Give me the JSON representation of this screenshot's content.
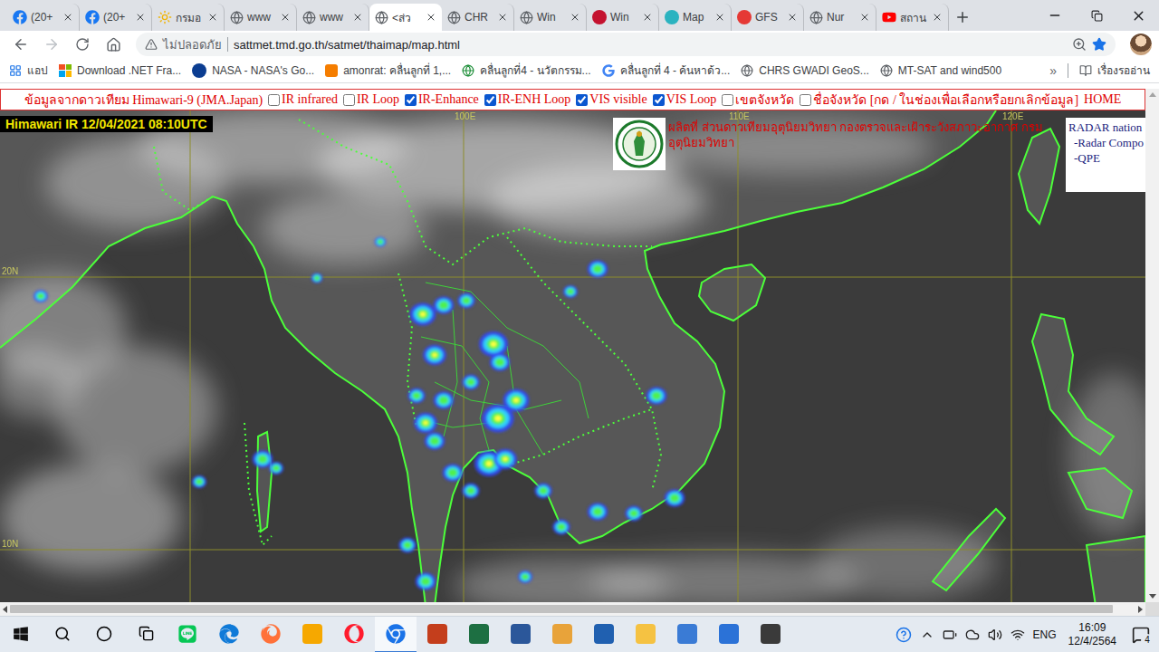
{
  "browser": {
    "tabs": [
      {
        "title": "(20+",
        "icon": "facebook",
        "selected": false
      },
      {
        "title": "(20+",
        "icon": "facebook",
        "selected": false
      },
      {
        "title": "กรมอ",
        "icon": "sun",
        "selected": false
      },
      {
        "title": "www",
        "icon": "globe",
        "selected": false
      },
      {
        "title": "www",
        "icon": "globe",
        "selected": false
      },
      {
        "title": "<ส่ว",
        "icon": "globe",
        "selected": true
      },
      {
        "title": "CHR",
        "icon": "globe",
        "selected": false
      },
      {
        "title": "Win",
        "icon": "globe",
        "selected": false
      },
      {
        "title": "Win",
        "icon": "red",
        "selected": false
      },
      {
        "title": "Map",
        "icon": "teal",
        "selected": false
      },
      {
        "title": "GFS",
        "icon": "swirl",
        "selected": false
      },
      {
        "title": "Nur",
        "icon": "globe",
        "selected": false
      },
      {
        "title": "สถาน",
        "icon": "youtube",
        "selected": false
      }
    ],
    "address_bar": {
      "security": "ไม่ปลอดภัย",
      "url": "sattmet.tmd.go.th/satmet/thaimap/map.html",
      "bookmarked": true
    },
    "bookmarks": [
      {
        "label": "แอป",
        "icon": "apps"
      },
      {
        "label": "Download .NET Fra...",
        "icon": "windows"
      },
      {
        "label": "NASA - NASA's Go...",
        "icon": "nasa"
      },
      {
        "label": "amonrat: คลื่นลูกที่ 1,...",
        "icon": "blogger"
      },
      {
        "label": "คลื่นลูกที่4 - นวัตกรรม...",
        "icon": "earth"
      },
      {
        "label": "คลื่นลูกที่ 4 - ค้นหาด้ว...",
        "icon": "google"
      },
      {
        "label": "CHRS GWADI GeoS...",
        "icon": "globe"
      },
      {
        "label": "MT-SAT and wind500",
        "icon": "globe"
      }
    ],
    "bookmarks_more": "»",
    "reading_list": "เรื่องรออ่าน"
  },
  "page": {
    "header": {
      "source": "ข้อมูลจากดาวเทียม Himawari-9 (JMA.Japan)",
      "options": [
        {
          "label": "IR infrared",
          "checked": false
        },
        {
          "label": "IR Loop",
          "checked": false
        },
        {
          "label": "IR-Enhance",
          "checked": true
        },
        {
          "label": "IR-ENH Loop",
          "checked": true
        },
        {
          "label": "VIS visible",
          "checked": true
        },
        {
          "label": "VIS Loop",
          "checked": true
        },
        {
          "label": "เขตจังหวัด",
          "checked": false
        },
        {
          "label": "ชื่อจังหวัด [กด / ในช่องเพื่อเลือกหรือยกเลิกข้อมูล]",
          "checked": false
        }
      ],
      "home": "HOME"
    },
    "map": {
      "timestamp": "Himawari IR 12/04/2021 08:10UTC",
      "credit": "ผลิตที่ ส่วนดาวเทียมอุตุนิยมวิทยา กองตรวจและเฝ้าระวังสภาวะอากาศ กรมอุตุนิยมวิทยา",
      "radar_links": [
        "RADAR nation",
        "-Radar Compo",
        "-QPE"
      ],
      "longitudes": [
        "100E",
        "110E",
        "120E"
      ],
      "latitudes": [
        "20N",
        "10N"
      ]
    },
    "horizontal_scroll": {
      "level": 0.98
    }
  },
  "taskbar": {
    "apps": [
      {
        "kind": "line",
        "active": false
      },
      {
        "kind": "edge",
        "active": false
      },
      {
        "kind": "firefox",
        "active": false
      },
      {
        "kind": "paint",
        "active": false
      },
      {
        "kind": "opera",
        "active": false
      },
      {
        "kind": "chrome",
        "active": true
      },
      {
        "kind": "powerpoint",
        "active": false
      },
      {
        "kind": "excel",
        "active": false
      },
      {
        "kind": "word",
        "active": false
      },
      {
        "kind": "player",
        "active": false
      },
      {
        "kind": "camera",
        "active": false
      },
      {
        "kind": "explorer",
        "active": false
      },
      {
        "kind": "store",
        "active": false
      },
      {
        "kind": "mail",
        "active": false
      },
      {
        "kind": "obs",
        "active": false
      }
    ],
    "language": "ENG",
    "time": "16:09",
    "date": "12/4/2564",
    "notifications": "4"
  }
}
